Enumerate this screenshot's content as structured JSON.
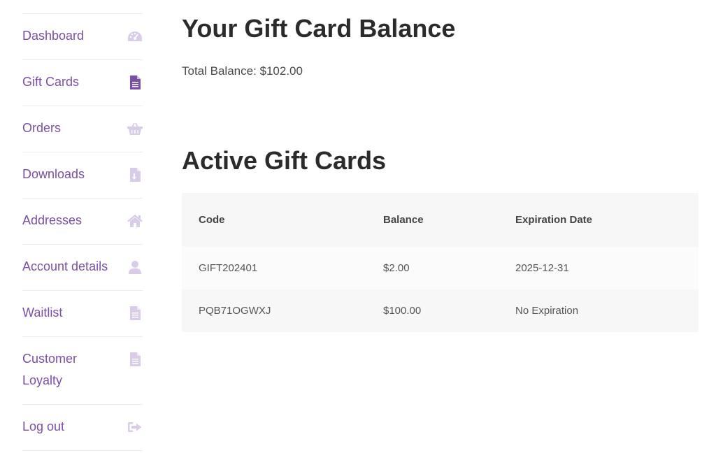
{
  "sidebar": {
    "items": [
      {
        "label": "Dashboard",
        "icon": "dashboard-gauge-icon",
        "active": false
      },
      {
        "label": "Gift Cards",
        "icon": "document-icon",
        "active": true
      },
      {
        "label": "Orders",
        "icon": "basket-icon",
        "active": false
      },
      {
        "label": "Downloads",
        "icon": "file-download-icon",
        "active": false
      },
      {
        "label": "Addresses",
        "icon": "home-icon",
        "active": false
      },
      {
        "label": "Account details",
        "icon": "user-icon",
        "active": false
      },
      {
        "label": "Waitlist",
        "icon": "document-icon",
        "active": false
      },
      {
        "label": "Customer Loyalty",
        "icon": "document-icon",
        "active": false
      },
      {
        "label": "Log out",
        "icon": "sign-out-icon",
        "active": false
      }
    ]
  },
  "main": {
    "balance_title": "Your Gift Card Balance",
    "total_balance": "Total Balance: $102.00",
    "active_title": "Active Gift Cards",
    "table": {
      "headers": [
        "Code",
        "Balance",
        "Expiration Date"
      ],
      "rows": [
        [
          "GIFT202401",
          "$2.00",
          "2025-12-31"
        ],
        [
          "PQB71OGWXJ",
          "$100.00",
          "No Expiration"
        ]
      ]
    }
  },
  "colors": {
    "link": "#7b4fa6",
    "icon_inactive": "#d8cce8",
    "icon_active": "#7b4fa6",
    "heading": "#2b2b2b"
  }
}
